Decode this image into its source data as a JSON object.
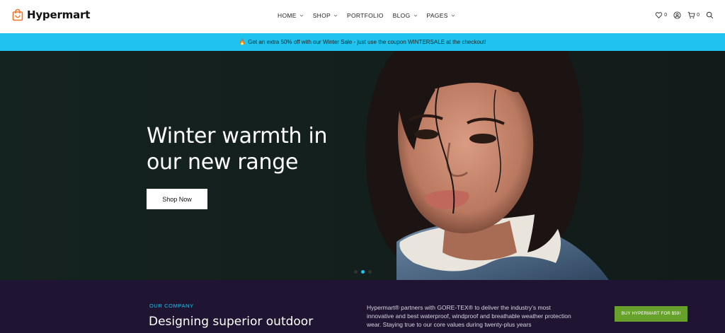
{
  "header": {
    "logo_text": "Hypermart",
    "nav": [
      {
        "label": "HOME",
        "dropdown": true
      },
      {
        "label": "SHOP",
        "dropdown": true
      },
      {
        "label": "PORTFOLIO",
        "dropdown": false
      },
      {
        "label": "BLOG",
        "dropdown": true
      },
      {
        "label": "PAGES",
        "dropdown": true
      }
    ],
    "wishlist_count": "0",
    "cart_count": "0",
    "icons": [
      "heart-icon",
      "user-icon",
      "cart-icon",
      "search-icon"
    ]
  },
  "promo": {
    "icon": "fire-icon",
    "text": "Get an extra 50% off with our Winter Sale - just use the coupon WINTERSALE at the checkout!"
  },
  "hero": {
    "title_line1": "Winter warmth in",
    "title_line2": "our new range",
    "button_label": "Shop Now",
    "slides": 3,
    "active_slide": 2
  },
  "company": {
    "eyebrow": "OUR COMPANY",
    "title": "Designing superior outdoor clothing -",
    "text": "Hypermart® partners with GORE-TEX® to deliver the industry’s most innovative and best waterproof, windproof and breathable weather protection wear. Staying true to our core values during twenty-plus years",
    "buy_button": "BUY HYPERMART FOR $59!"
  },
  "colors": {
    "promo_bg": "#1ec3ee",
    "hero_bg": "#14201e",
    "company_bg": "#1f1532",
    "accent": "#1ec3ee",
    "buy_button_bg": "#67a32a",
    "logo_accent": "#f0732a"
  }
}
